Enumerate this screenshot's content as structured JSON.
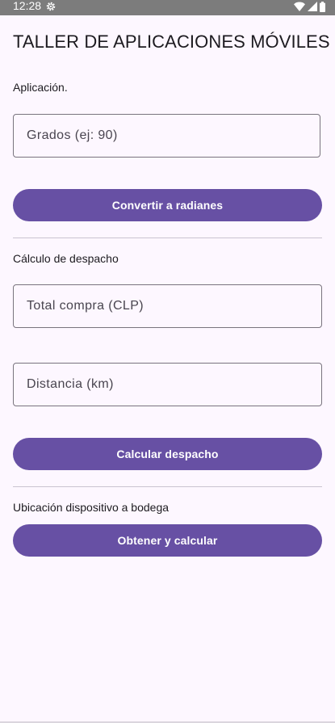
{
  "status_bar": {
    "time": "12:28",
    "icons": [
      "settings-icon",
      "wifi-icon",
      "signal-icon",
      "battery-icon"
    ],
    "background": "#7C7C7C"
  },
  "title": "TALLER DE APLICACIONES MÓVILES",
  "sections": {
    "aplicacion": {
      "label": "Aplicación.",
      "degrees_field": {
        "value": "",
        "placeholder": "Grados (ej: 90)"
      },
      "button_label": "Convertir a radianes"
    },
    "despacho": {
      "label": "Cálculo de despacho",
      "total_field": {
        "value": "",
        "placeholder": "Total compra (CLP)"
      },
      "distance_field": {
        "value": "",
        "placeholder": "Distancia (km)"
      },
      "button_label": "Calcular despacho"
    },
    "ubicacion": {
      "label": "Ubicación dispositivo a bodega",
      "button_label": "Obtener y calcular"
    }
  },
  "colors": {
    "primary": "#6750A4",
    "background": "#FDF7FF",
    "outline": "#79747E",
    "divider": "#CAC4D0"
  }
}
